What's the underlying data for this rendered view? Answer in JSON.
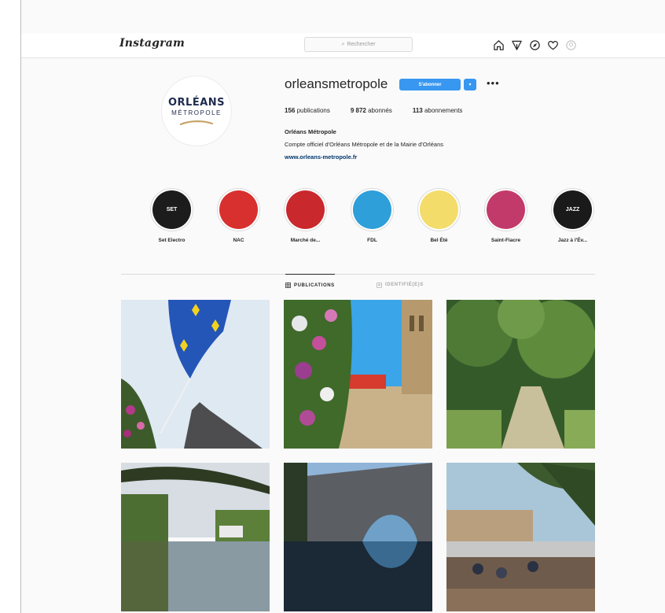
{
  "app": {
    "logo_text": "Instagram",
    "search_placeholder": "Rechercher",
    "nav_icons": [
      "home-icon",
      "direct-icon",
      "explore-icon",
      "activity-heart-icon",
      "profile-icon"
    ]
  },
  "profile": {
    "username": "orleansmetropole",
    "follow_label": "S'abonner",
    "caret_symbol": "▾",
    "more_symbol": "•••",
    "stats": [
      {
        "value": "156",
        "label": "publications"
      },
      {
        "value": "9 872",
        "label": "abonnés"
      },
      {
        "value": "113",
        "label": "abonnements"
      }
    ],
    "full_name": "Orléans Métropole",
    "bio": "Compte officiel d'Orléans Métropole et de la Mairie d'Orléans",
    "website": "www.orleans-metropole.fr",
    "avatar_line1": "ORLÉANS",
    "avatar_line2": "MÉTROPOLE"
  },
  "highlights": [
    {
      "label": "Set Electro",
      "cover_text": "SET",
      "color": "#1c1c1c"
    },
    {
      "label": "NAC",
      "cover_text": "",
      "color": "#d8302f"
    },
    {
      "label": "Marché de...",
      "cover_text": "",
      "color": "#c9282d"
    },
    {
      "label": "FDL",
      "cover_text": "",
      "color": "#2e9fd9"
    },
    {
      "label": "Bel Été",
      "cover_text": "",
      "color": "#f3dc6a"
    },
    {
      "label": "Saint-Fiacre",
      "cover_text": "",
      "color": "#c23a6a"
    },
    {
      "label": "Jazz à l'Év...",
      "cover_text": "JAZZ",
      "color": "#1a1a1a"
    }
  ],
  "tabs": [
    {
      "label": "PUBLICATIONS",
      "active": true
    },
    {
      "label": "IDENTIFIÉ(E)S",
      "active": false
    }
  ],
  "colors": {
    "accent": "#3897f0",
    "link": "#00376b"
  }
}
